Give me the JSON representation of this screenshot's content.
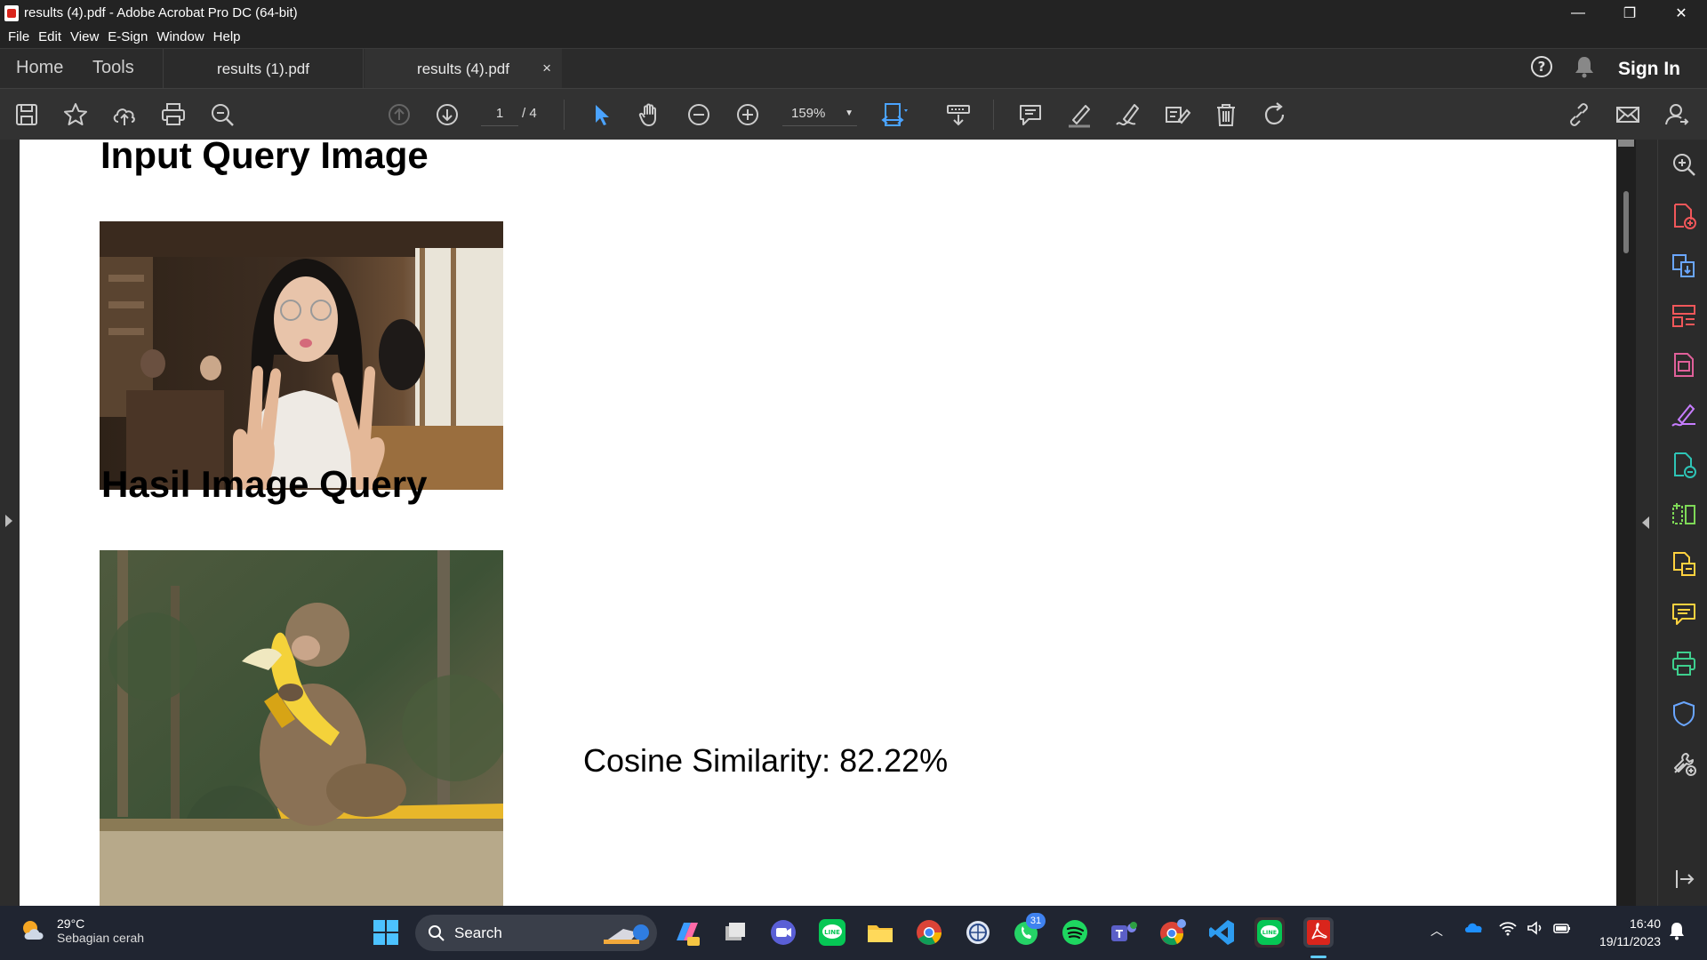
{
  "window": {
    "title": "results (4).pdf - Adobe Acrobat Pro DC (64-bit)",
    "controls": [
      "—",
      "❐",
      "✕"
    ]
  },
  "menu": [
    "File",
    "Edit",
    "View",
    "E-Sign",
    "Window",
    "Help"
  ],
  "tabs": {
    "home": "Home",
    "tools": "Tools",
    "docs": [
      {
        "label": "results (1).pdf",
        "active": false
      },
      {
        "label": "results (4).pdf",
        "active": true
      }
    ],
    "close": "×",
    "sign_in": "Sign In"
  },
  "toolbar": {
    "page_current": "1",
    "page_total": "/ 4",
    "zoom": "159%"
  },
  "document": {
    "heading_input": "Input Query Image",
    "heading_result": "Hasil Image Query",
    "similarity": "Cosine Similarity: 82.22%"
  },
  "taskbar": {
    "weather_temp": "29°C",
    "weather_cond": "Sebagian cerah",
    "search_label": "Search",
    "whatsapp_badge": "31",
    "clock_time": "16:40",
    "clock_date": "19/11/2023"
  },
  "colors": {
    "accent_blue": "#4aa3ff",
    "acrobat_red": "#d9251c"
  }
}
